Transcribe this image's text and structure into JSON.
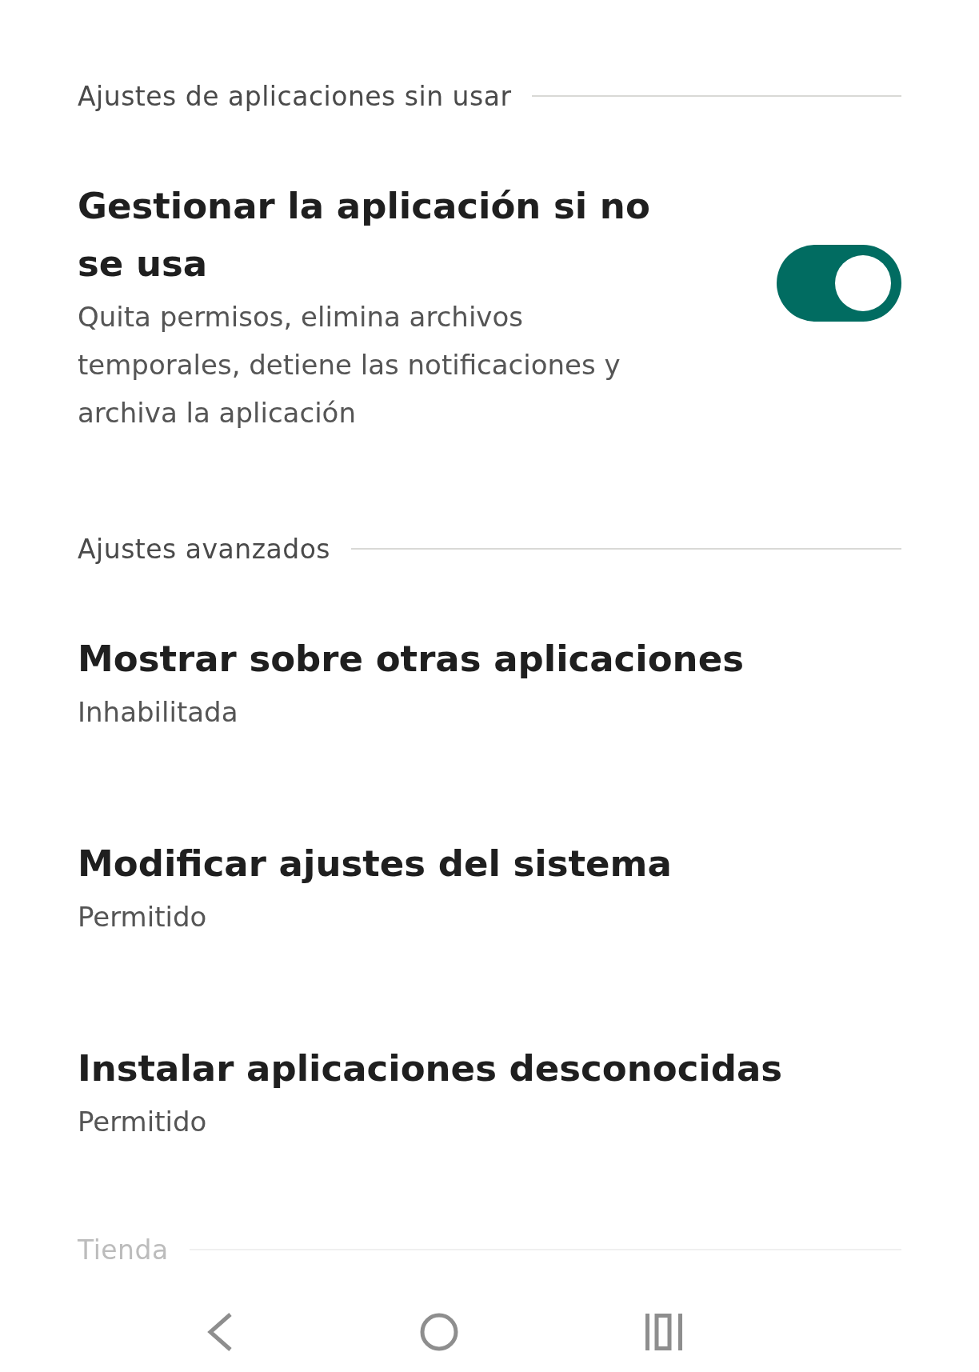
{
  "sections": [
    {
      "header": "Ajustes de aplicaciones sin usar",
      "faded": false,
      "items": [
        {
          "kind": "toggle",
          "title": "Gestionar la aplicación si no se usa",
          "subtitle": "Quita permisos, elimina archivos temporales, detiene las notificaciones y archiva la aplicación",
          "on": true
        }
      ]
    },
    {
      "header": "Ajustes avanzados",
      "faded": false,
      "items": [
        {
          "kind": "link",
          "title": "Mostrar sobre otras aplicaciones",
          "subtitle": "Inhabilitada"
        },
        {
          "kind": "link",
          "title": "Modificar ajustes del sistema",
          "subtitle": "Permitido"
        },
        {
          "kind": "link",
          "title": "Instalar aplicaciones desconocidas",
          "subtitle": "Permitido"
        }
      ]
    },
    {
      "header": "Tienda",
      "faded": true
    }
  ]
}
